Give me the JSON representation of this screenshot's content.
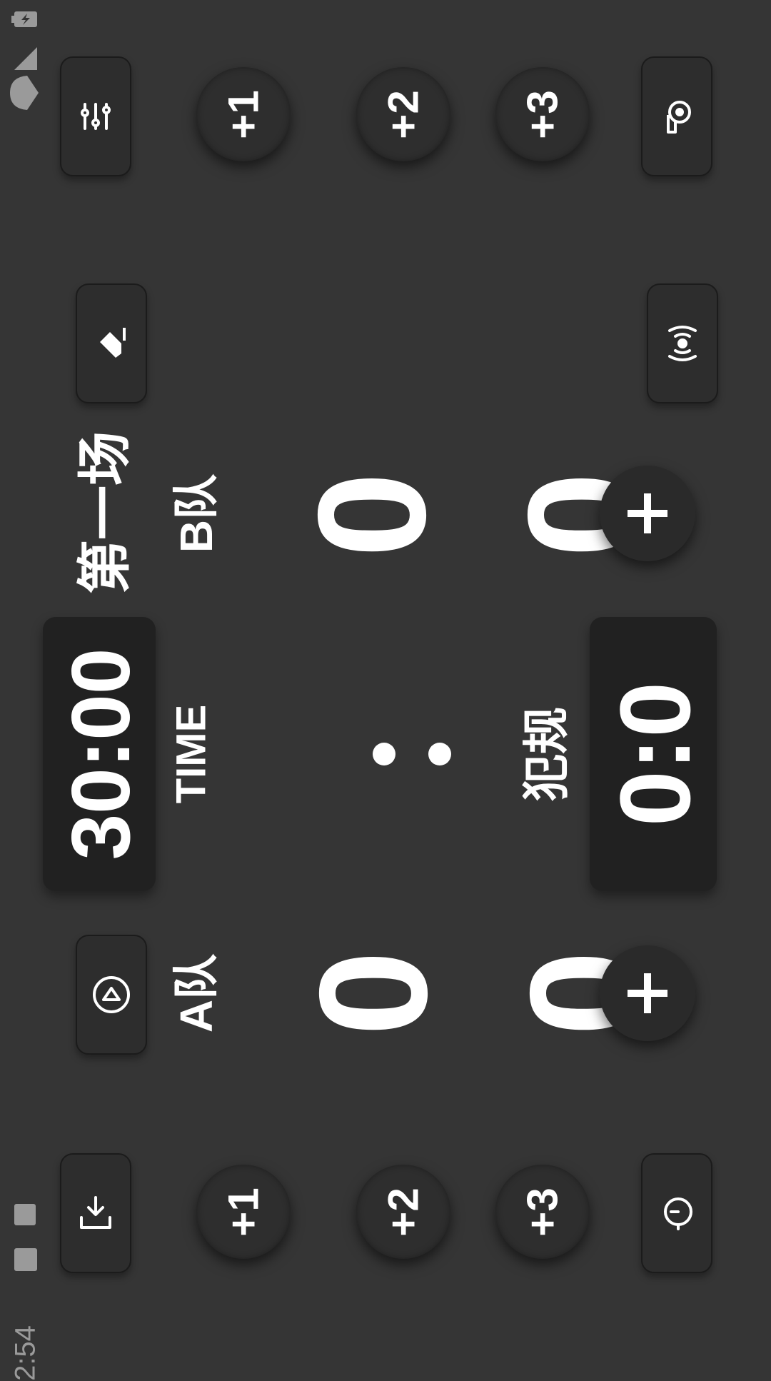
{
  "status_bar": {
    "time": "2:54",
    "icons": [
      "battery-charging-icon",
      "signal-icon",
      "wifi-icon",
      "image-notification-icon",
      "a-notification-icon"
    ]
  },
  "match": {
    "title": "第一场"
  },
  "team_b": {
    "label": "B队",
    "score_main": "0",
    "score_secondary": "0"
  },
  "team_a": {
    "label": "A队",
    "score_main": "0",
    "score_secondary": "0"
  },
  "timer": {
    "label": "TIME",
    "value": "30:00"
  },
  "fouls": {
    "label": "犯规",
    "value": "0:0"
  },
  "increments_b": [
    "+1",
    "+2",
    "+3"
  ],
  "increments_a": [
    "+1",
    "+2",
    "+3"
  ],
  "colors": {
    "background": "#353535",
    "button": "#2d2d2d",
    "panel": "#212121",
    "text": "#ffffff"
  }
}
